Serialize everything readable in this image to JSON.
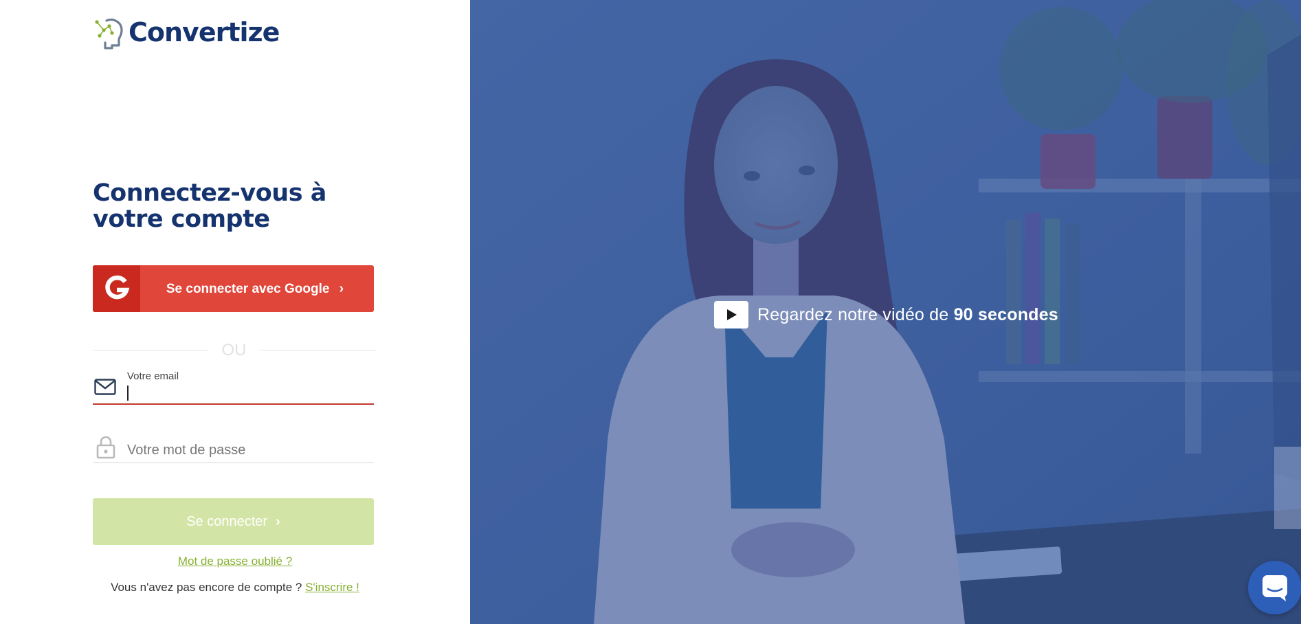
{
  "brand": {
    "name": "Convertize",
    "primary_color": "#15336e",
    "accent_green": "#86b031"
  },
  "login": {
    "title": "Connectez-vous à votre compte",
    "google_button_label": "Se connecter avec Google",
    "google_button_color": "#e0463a",
    "divider_text": "OU",
    "email_label": "Votre email",
    "email_value": "",
    "password_placeholder": "Votre mot de passe",
    "submit_label": "Se connecter",
    "submit_color": "#d3e5a6",
    "forgot_password_link": "Mot de passe oublié ?",
    "no_account_text": "Vous n'avez pas encore de compte ?",
    "signup_link": "S'inscrire !"
  },
  "hero": {
    "video_cta_prefix": "Regardez notre vidéo de",
    "video_cta_bold": "90 secondes",
    "overlay_color": "#3d5f9f"
  },
  "icons": [
    "convertize-logo-icon",
    "google-icon",
    "mail-icon",
    "lock-icon",
    "play-icon",
    "chat-icon"
  ]
}
